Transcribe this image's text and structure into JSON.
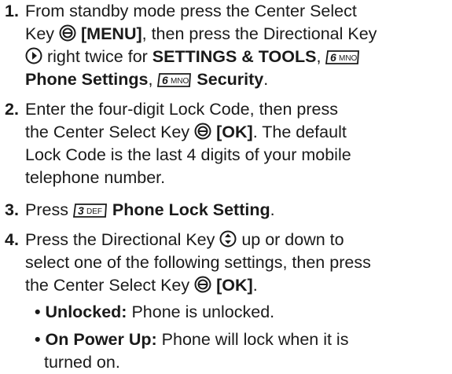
{
  "steps": [
    {
      "number": "1.",
      "lines": {
        "a": "From standby mode press the Center Select",
        "b1": "Key ",
        "b2": "[MENU]",
        "b3": ", then press the Directional Key",
        "c1": " right twice for ",
        "c2": "SETTINGS & TOOLS",
        "c3": ",",
        "d1": "Phone Settings",
        "d2": ", ",
        "d3": "Security",
        "d4": "."
      }
    },
    {
      "number": "2.",
      "lines": {
        "a": "Enter the four-digit Lock Code, then press",
        "b1": "the Center Select Key ",
        "b2": "[OK]",
        "b3": ".  The default",
        "c": "Lock Code is the last 4 digits of your mobile",
        "d": "telephone number."
      }
    },
    {
      "number": "3.",
      "lines": {
        "a1": "Press ",
        "a2": "Phone Lock Setting",
        "a3": "."
      }
    },
    {
      "number": "4.",
      "lines": {
        "a1": "Press the Directional Key ",
        "a2": " up or down to",
        "b": "select one of the following settings, then press",
        "c1": "the Center Select Key ",
        "c2": "[OK]",
        "c3": "."
      }
    }
  ],
  "bullets": [
    {
      "term": "Unlocked:",
      "text": " Phone is unlocked."
    },
    {
      "term": "On Power Up:",
      "text": " Phone will lock when it is",
      "cont": "turned on."
    }
  ],
  "keypad_keys": [
    {
      "digit": "6",
      "letters": "MNO"
    },
    {
      "digit": "3",
      "letters": "DEF"
    }
  ],
  "icons": [
    "center-select-key-icon",
    "directional-right-icon",
    "directional-updown-icon",
    "keypad-6-mno-icon",
    "keypad-3-def-icon"
  ]
}
